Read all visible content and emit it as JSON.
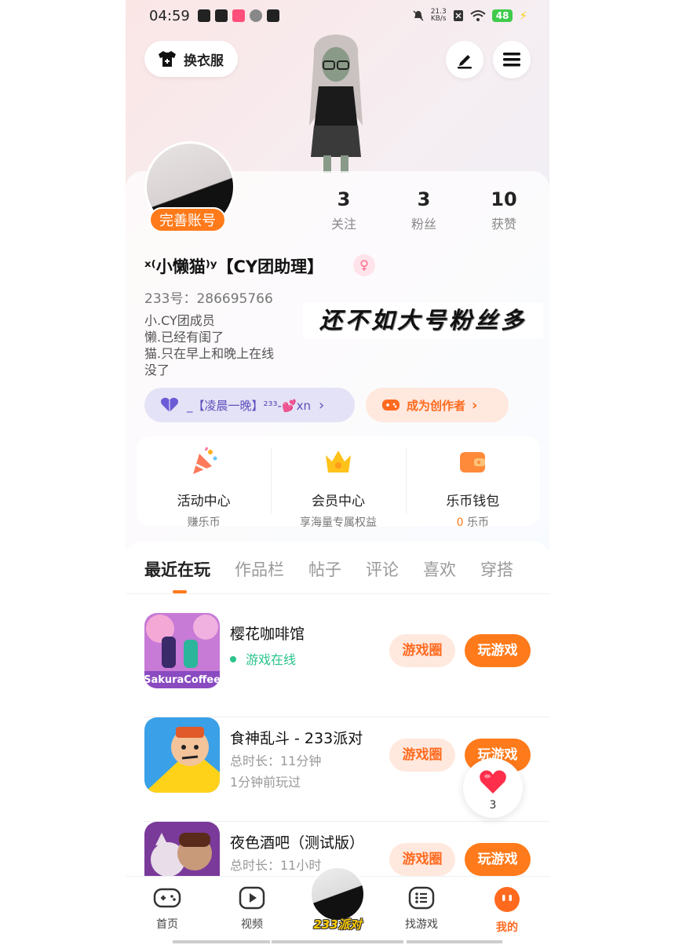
{
  "status_bar": {
    "time": "04:59",
    "net_speed_value": "21.3",
    "net_speed_unit": "KB/s",
    "battery": "48"
  },
  "header": {
    "dress_up_label": "换衣服"
  },
  "profile": {
    "complete_account_label": "完善账号",
    "stats": [
      {
        "value": "3",
        "label": "关注"
      },
      {
        "value": "3",
        "label": "粉丝"
      },
      {
        "value": "10",
        "label": "获赞"
      }
    ],
    "nickname": "ˣ⁽小懒猫⁾ʸ【CY团助理】",
    "gender_symbol": "♀",
    "uid_text": "233号：286695766",
    "bio_lines": [
      "小.CY团成员",
      "懒.已经有闺了",
      "猫.只在早上和晚上在线",
      "没了"
    ],
    "overlay_text": "还不如大号粉丝多",
    "group_pill": {
      "text": "_【凌晨一晚】²³³-💕xn"
    },
    "creator_pill": {
      "text": "成为创作者"
    }
  },
  "entries": [
    {
      "title": "活动中心",
      "subtitle": "赚乐币"
    },
    {
      "title": "会员中心",
      "subtitle": "享海量专属权益"
    },
    {
      "title": "乐币钱包",
      "subtitle_value": "0",
      "subtitle": "乐币"
    }
  ],
  "tabs": [
    "最近在玩",
    "作品栏",
    "帖子",
    "评论",
    "喜欢",
    "穿搭"
  ],
  "games": [
    {
      "name": "樱花咖啡馆",
      "status": "游戏在线",
      "circle_label": "游戏圈",
      "play_label": "玩游戏"
    },
    {
      "name": "食神乱斗 - 233派对",
      "duration": "总时长：11分钟",
      "last_played": "1分钟前玩过",
      "circle_label": "游戏圈",
      "play_label": "玩游戏"
    },
    {
      "name": "夜色酒吧（测试版）",
      "duration": "总时长：11小时",
      "circle_label": "游戏圈",
      "play_label": "玩游戏"
    }
  ],
  "like_float": {
    "count": "3"
  },
  "bottom_nav": {
    "items": [
      {
        "label": "首页"
      },
      {
        "label": "视频"
      },
      {
        "label": "233派对"
      },
      {
        "label": "找游戏"
      },
      {
        "label": "我的"
      }
    ]
  },
  "colors": {
    "accent": "#ff7a1a",
    "online": "#2bc48a",
    "group_pill_text": "#5d4fbd"
  }
}
